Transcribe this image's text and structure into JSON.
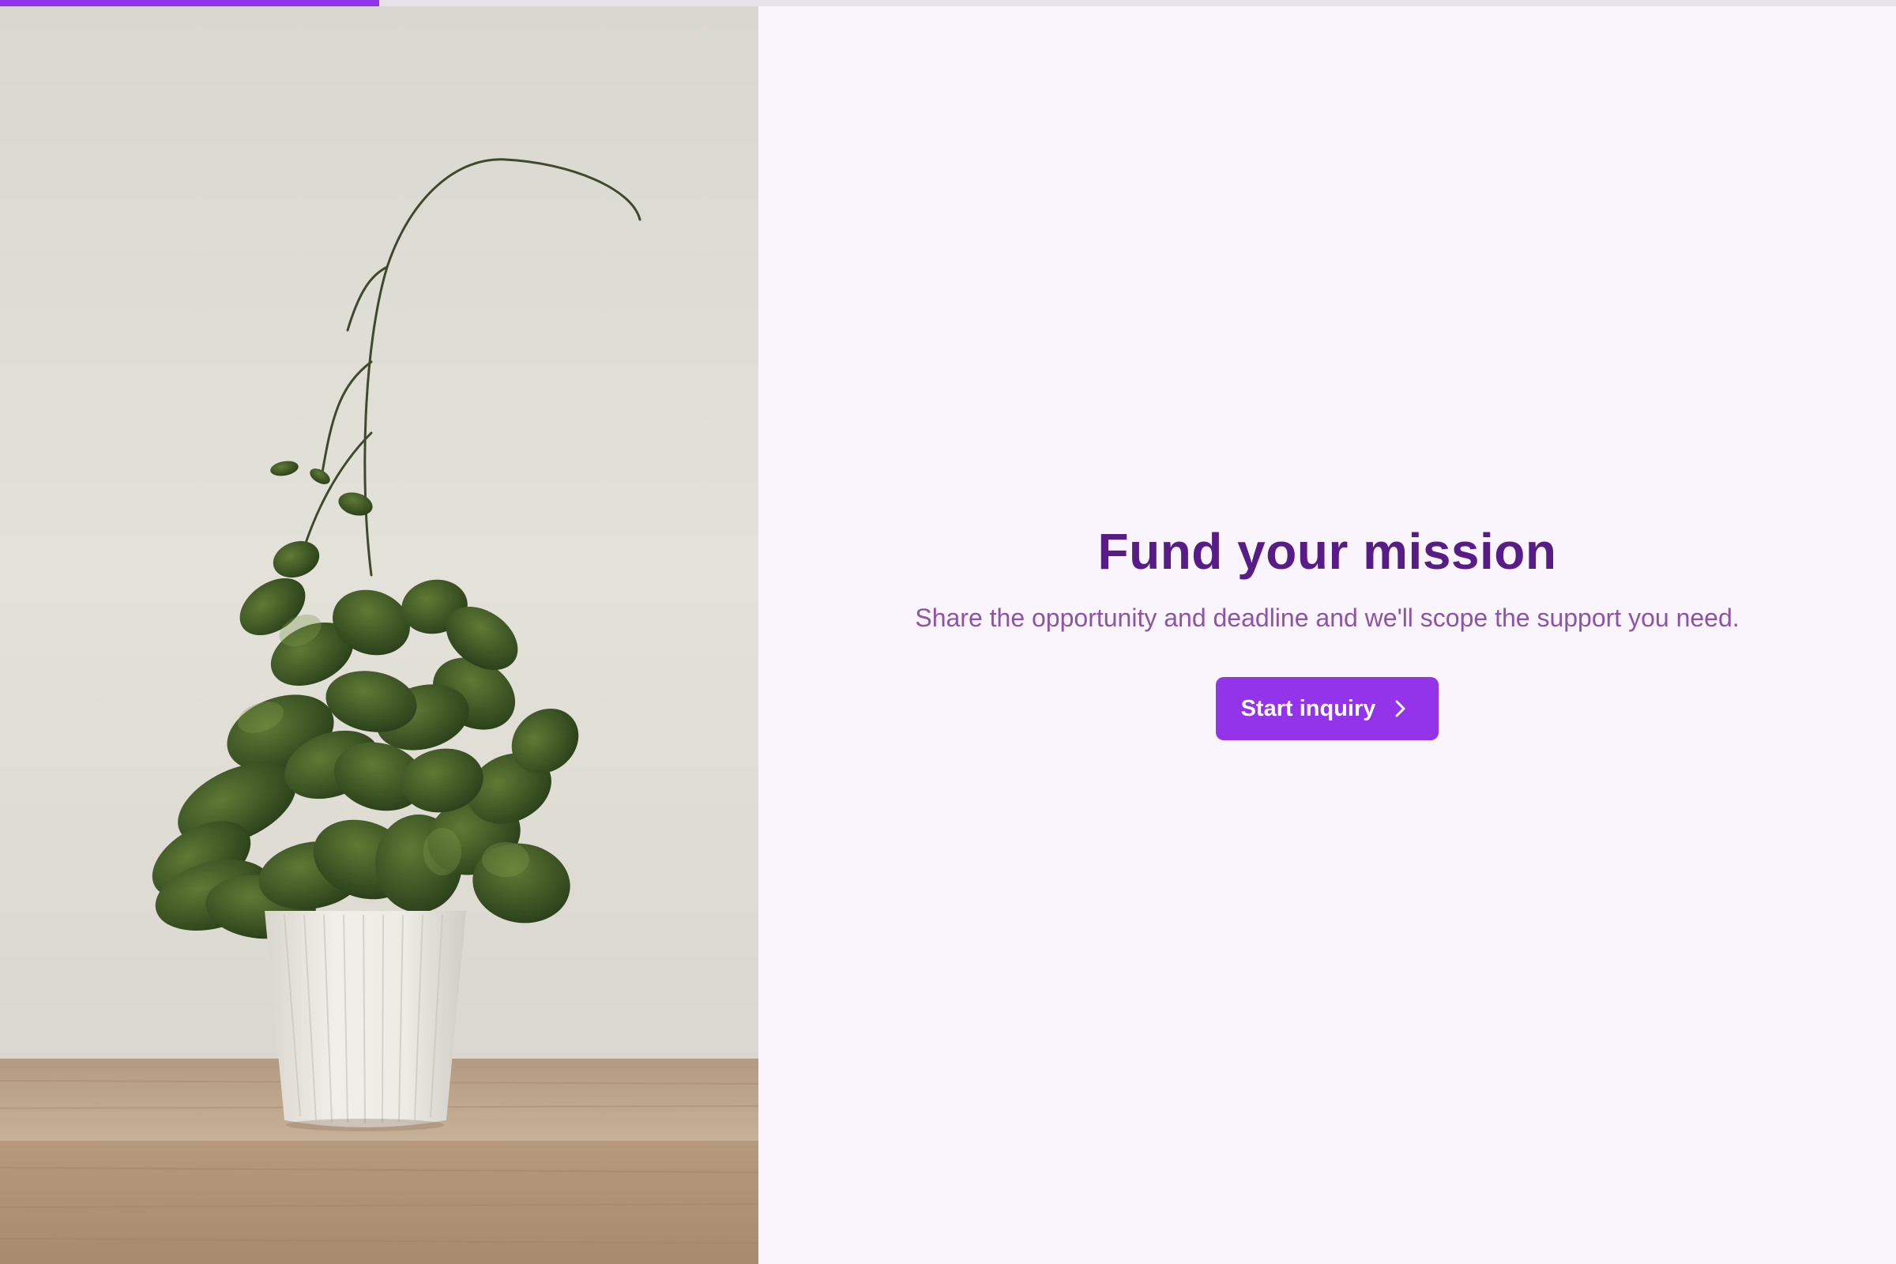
{
  "progress": {
    "percent": 20,
    "color": "#9333ea",
    "track_color": "#e6e2e9"
  },
  "hero_image": {
    "subject": "potted-plant-photo"
  },
  "content": {
    "title": "Fund your mission",
    "subtitle": "Share the opportunity and deadline and we'll scope the support you need.",
    "cta_label": "Start inquiry",
    "cta_icon": "chevron-right-icon"
  },
  "colors": {
    "accent": "#9333ea",
    "title": "#581c87",
    "subtitle": "#8b54a6",
    "background": "#faf4fc"
  }
}
